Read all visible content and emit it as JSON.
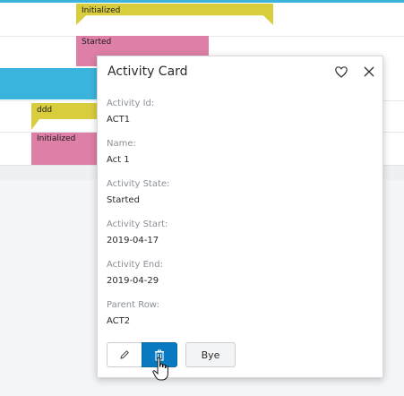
{
  "gantt": {
    "bars": [
      {
        "label": "Initialized"
      },
      {
        "label": "Started"
      },
      {
        "label": "ddd"
      },
      {
        "label": "Initialized"
      }
    ]
  },
  "card": {
    "title": "Activity Card",
    "fields": [
      {
        "label": "Activity Id:",
        "value": "ACT1"
      },
      {
        "label": "Name:",
        "value": "Act 1"
      },
      {
        "label": "Activity State:",
        "value": "Started"
      },
      {
        "label": "Activity Start:",
        "value": "2019-04-17"
      },
      {
        "label": "Activity End:",
        "value": "2019-04-29"
      },
      {
        "label": "Parent Row:",
        "value": "ACT2"
      }
    ],
    "buttons": {
      "bye": "Bye"
    },
    "icons": {
      "favorite": "heart-icon",
      "close": "close-icon",
      "edit": "pencil-icon",
      "delete": "trash-icon"
    }
  },
  "colors": {
    "accent": "#3bb4dd",
    "primary_button": "#0a7ac0",
    "bar_yellow": "#d8cd3c",
    "bar_pink": "#dd7fa6"
  }
}
